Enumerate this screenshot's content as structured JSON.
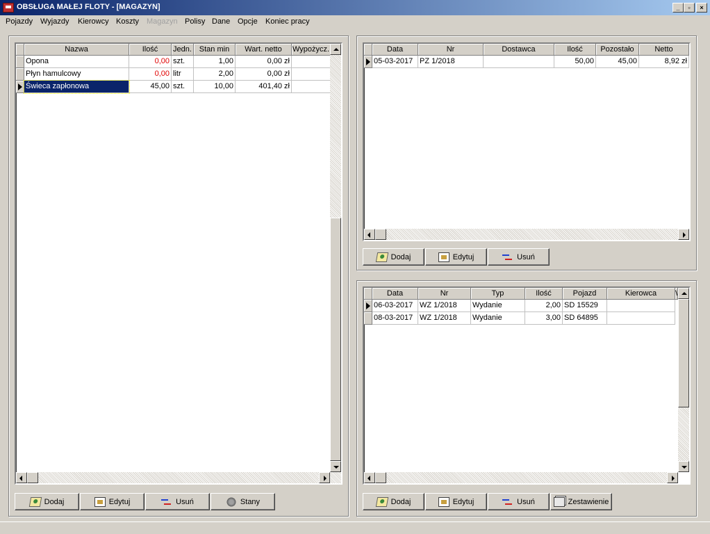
{
  "window": {
    "title": "OBSŁUGA MAŁEJ FLOTY - [MAGAZYN]",
    "controls": {
      "minimize": "_",
      "restore": "▫",
      "close": "×"
    }
  },
  "menu": [
    {
      "label": "Pojazdy",
      "enabled": true
    },
    {
      "label": "Wyjazdy",
      "enabled": true
    },
    {
      "label": "Kierowcy",
      "enabled": true
    },
    {
      "label": "Koszty",
      "enabled": true
    },
    {
      "label": "Magazyn",
      "enabled": false
    },
    {
      "label": "Polisy",
      "enabled": true
    },
    {
      "label": "Dane",
      "enabled": true
    },
    {
      "label": "Opcje",
      "enabled": true
    },
    {
      "label": "Koniec pracy",
      "enabled": true
    }
  ],
  "items_grid": {
    "columns": [
      "Nazwa",
      "Ilość",
      "Jedn.",
      "Stan min",
      "Wart. netto",
      "Wypożycz."
    ],
    "rows": [
      {
        "cells": [
          "Opona",
          "0,00",
          "szt.",
          "1,00",
          "0,00 zł",
          ""
        ],
        "qty_low": true
      },
      {
        "cells": [
          "Płyn hamulcowy",
          "0,00",
          "litr",
          "2,00",
          "0,00 zł",
          ""
        ],
        "qty_low": true
      },
      {
        "cells": [
          "Świeca zapłonowa",
          "45,00",
          "szt.",
          "10,00",
          "401,40 zł",
          ""
        ],
        "qty_low": false
      }
    ],
    "current_row": 2,
    "buttons": {
      "add": "Dodaj",
      "edit": "Edytuj",
      "delete": "Usuń",
      "states": "Stany"
    }
  },
  "receipts_grid": {
    "columns": [
      "Data",
      "Nr",
      "Dostawca",
      "Ilość",
      "Pozostało",
      "Netto"
    ],
    "rows": [
      [
        "05-03-2017",
        "PZ 1/2018",
        "",
        "50,00",
        "45,00",
        "8,92 zł"
      ]
    ],
    "buttons": {
      "add": "Dodaj",
      "edit": "Edytuj",
      "delete": "Usuń"
    }
  },
  "issues_grid": {
    "columns": [
      "Data",
      "Nr",
      "Typ",
      "Ilość",
      "Pojazd",
      "Kierowca",
      "W"
    ],
    "rows": [
      [
        "06-03-2017",
        "WZ 1/2018",
        "Wydanie",
        "2,00",
        "SD 15529",
        ""
      ],
      [
        "08-03-2017",
        "WZ 1/2018",
        "Wydanie",
        "3,00",
        "SD 64895",
        ""
      ]
    ],
    "buttons": {
      "add": "Dodaj",
      "edit": "Edytuj",
      "delete": "Usuń",
      "summary": "Zestawienie"
    }
  }
}
